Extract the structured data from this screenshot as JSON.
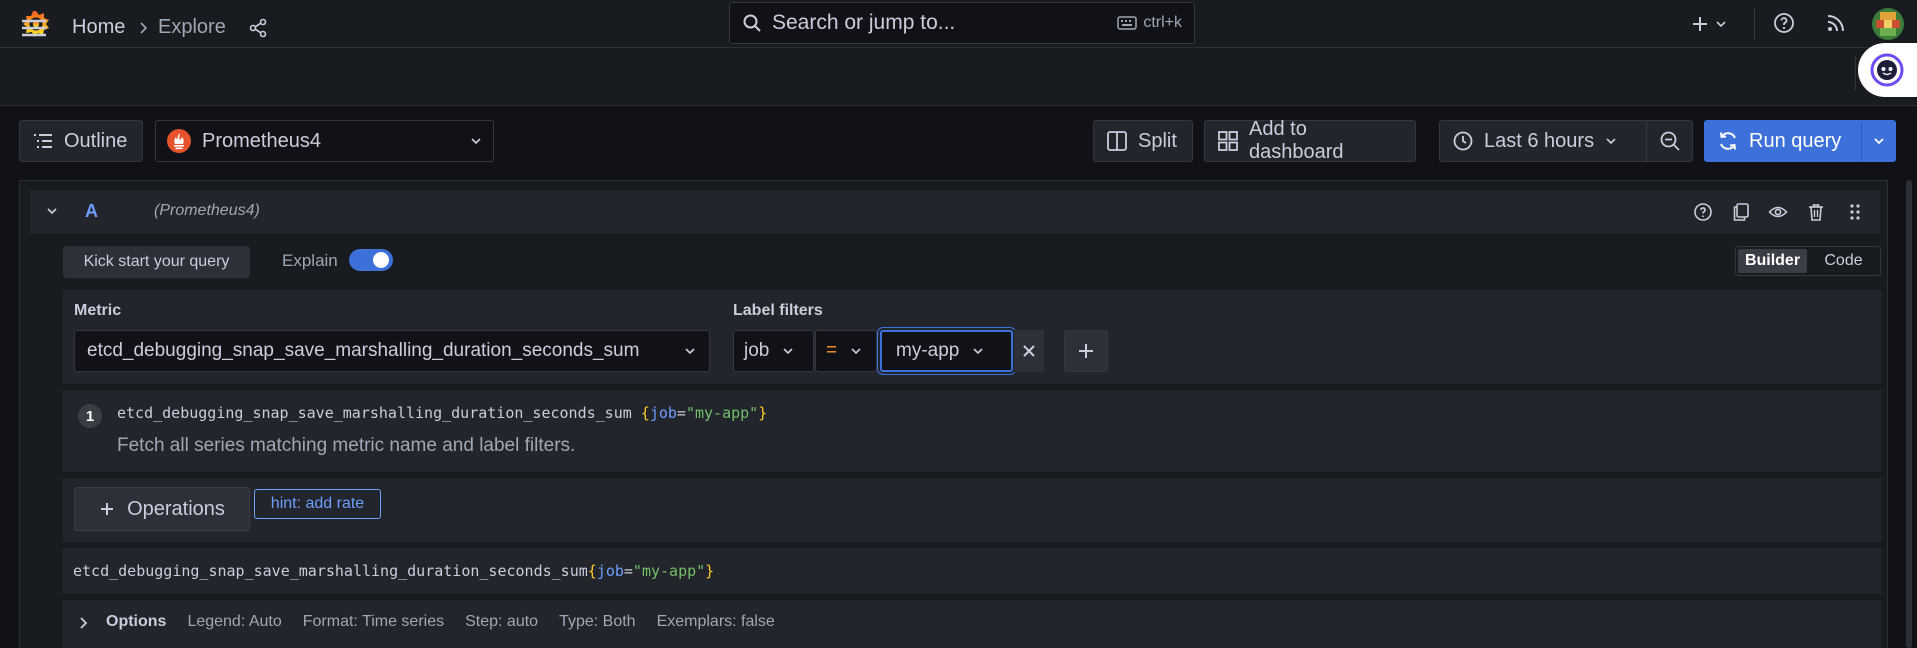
{
  "topbar": {
    "search_placeholder": "Search or jump to...",
    "search_shortcut": "ctrl+k",
    "icons": [
      "grafana-logo-icon",
      "search-icon",
      "keyboard-icon",
      "plus-icon",
      "chevron-down-icon",
      "help-icon",
      "news-icon",
      "user-avatar"
    ]
  },
  "breadcrumb": {
    "home": "Home",
    "current": "Explore"
  },
  "toolbar": {
    "outline_label": "Outline",
    "datasource": "Prometheus4",
    "split_label": "Split",
    "add_to_dashboard_label": "Add to dashboard",
    "time_range": "Last 6 hours",
    "run_query_label": "Run query"
  },
  "query": {
    "ref_id": "A",
    "datasource_label": "(Prometheus4)",
    "kick_start_label": "Kick start your query",
    "explain_label": "Explain",
    "explain_on": true,
    "mode_builder": "Builder",
    "mode_code": "Code",
    "active_mode": "Builder",
    "metric_label": "Metric",
    "metric_value": "etcd_debugging_snap_save_marshalling_duration_seconds_sum",
    "label_filters_label": "Label filters",
    "label_filter": {
      "key": "job",
      "operator": "=",
      "value": "my-app"
    },
    "explain": {
      "step": "1",
      "metric": "etcd_debugging_snap_save_marshalling_duration_seconds_sum",
      "open_brace": "{",
      "label_key": "job",
      "eq": "=",
      "label_value": "\"my-app\"",
      "close_brace": "}",
      "description": "Fetch all series matching metric name and label filters."
    },
    "operations_label": "Operations",
    "hint_label": "hint: add rate",
    "raw": {
      "metric": "etcd_debugging_snap_save_marshalling_duration_seconds_sum",
      "open_brace": "{",
      "label_key": "job",
      "eq": "=",
      "label_value": "\"my-app\"",
      "close_brace": "}"
    },
    "options": {
      "title": "Options",
      "legend": "Legend: Auto",
      "format": "Format: Time series",
      "step": "Step: auto",
      "type": "Type: Both",
      "exemplars": "Exemplars: false"
    }
  },
  "colors": {
    "background": "#111217",
    "panel": "#181b1f",
    "accent": "#3d71d9",
    "link": "#6e9fff",
    "brace": "#ffcb2b",
    "string": "#73bf69",
    "operator": "#ff9830"
  }
}
